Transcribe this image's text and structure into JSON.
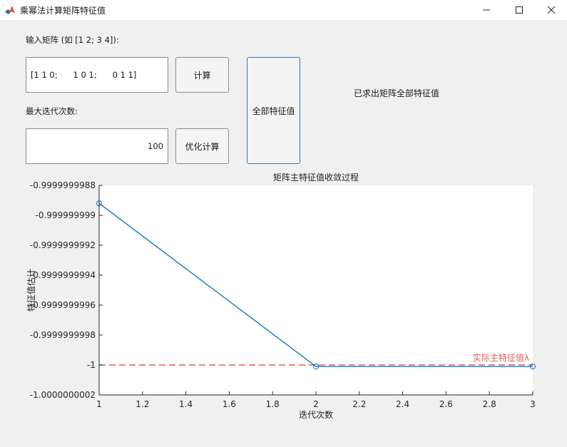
{
  "window": {
    "title": "乘幂法计算矩阵特征值",
    "icon": "matlab-icon"
  },
  "form": {
    "matrix_label": "输入矩阵 (如 [1 2; 3 4]):",
    "matrix_value": "[1 1 0;      1 0 1;      0 1 1]",
    "calc_button": "计算",
    "iter_label": "最大迭代次数:",
    "iter_value": "100",
    "opt_button": "优化计算",
    "all_button": "全部特征值",
    "status": "已求出矩阵全部特征值"
  },
  "chart_data": {
    "type": "line",
    "title": "矩阵主特征值收敛过程",
    "xlabel": "迭代次数",
    "ylabel": "特征值估计",
    "xlim": [
      1,
      3
    ],
    "ylim": [
      -1.0000000002,
      -0.9999999988
    ],
    "xticks": [
      "1",
      "1.2",
      "1.4",
      "1.6",
      "1.8",
      "2",
      "2.2",
      "2.4",
      "2.6",
      "2.8",
      "3"
    ],
    "yticks": [
      "-0.9999999988",
      "-0.999999999",
      "-0.9999999992",
      "-0.9999999994",
      "-0.9999999996",
      "-0.9999999998",
      "-1",
      "-1.0000000002"
    ],
    "series": [
      {
        "x": [
          1,
          2,
          3
        ],
        "y": [
          -0.99999999892,
          -1.00000000001,
          -1.00000000001
        ],
        "marker": "circle",
        "color": "#0072bd"
      }
    ],
    "reference": {
      "y": -1,
      "label": "实际主特征值λ",
      "color": "#e8595a",
      "style": "dashed"
    }
  }
}
